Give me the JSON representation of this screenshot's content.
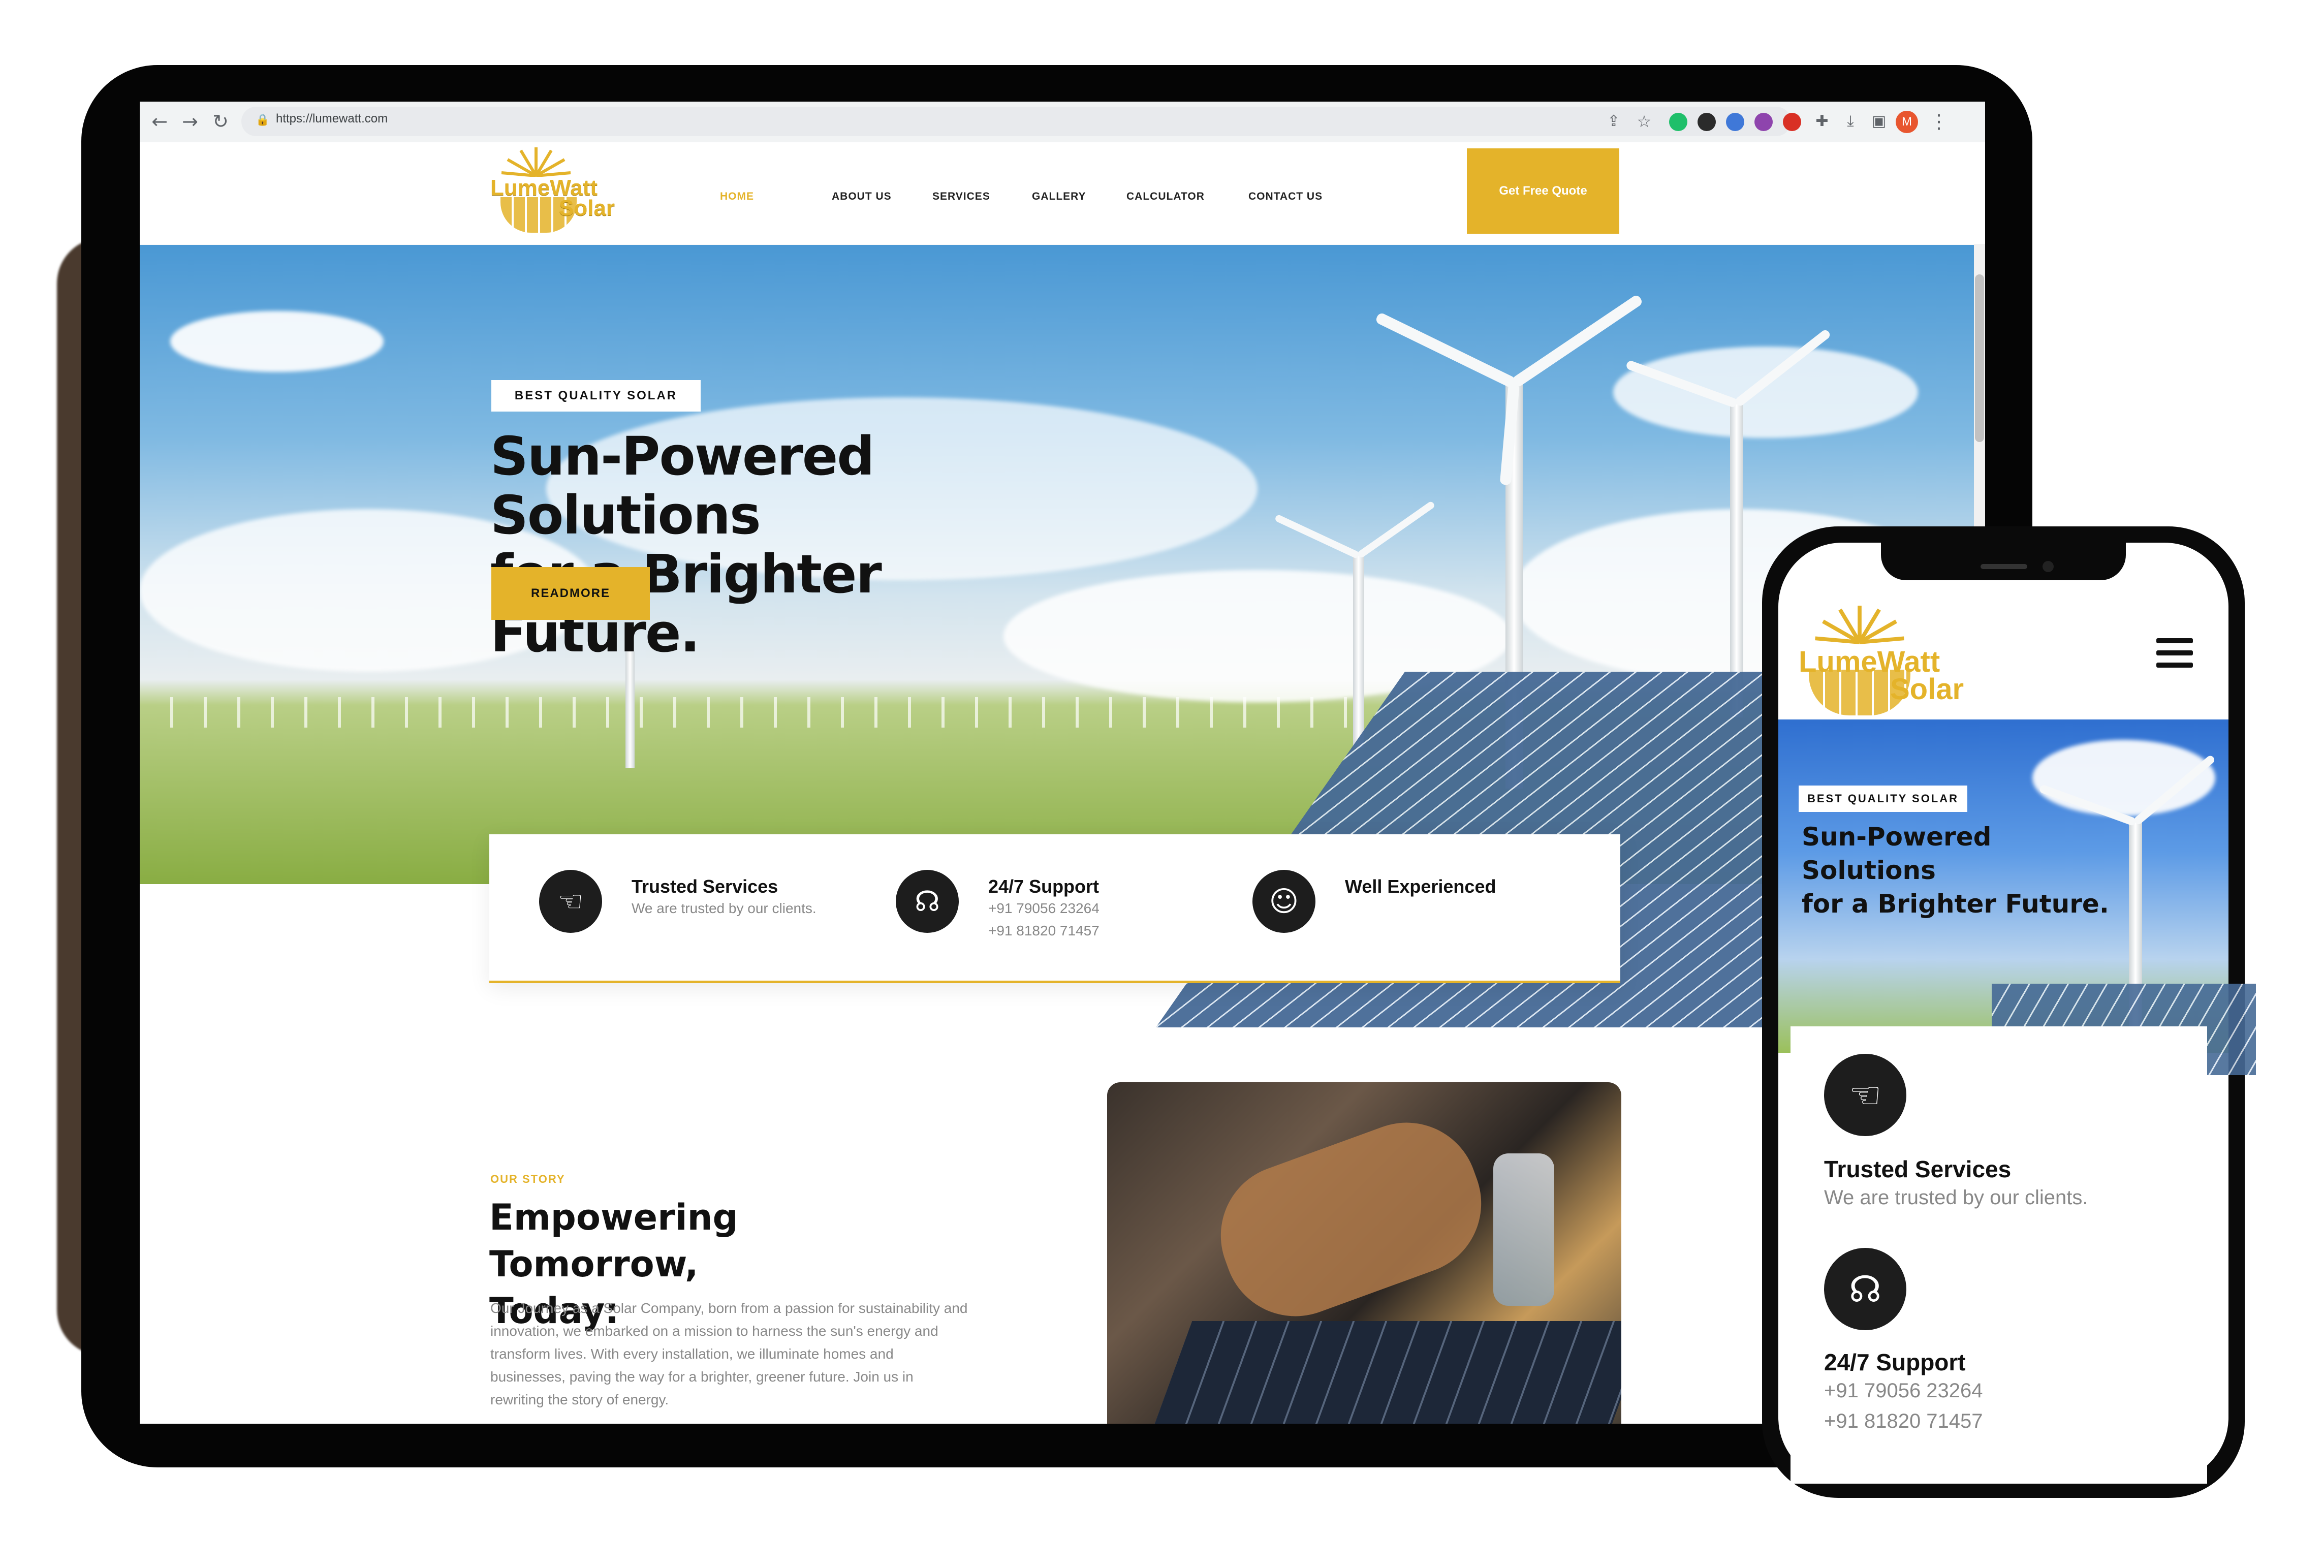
{
  "browser": {
    "url": "https://lumewatt.com",
    "avatar_letter": "M"
  },
  "brand": {
    "name_line1": "LumeWatt",
    "name_line2": "Solar",
    "accent": "#e4b32a"
  },
  "nav": {
    "items": [
      {
        "label": "HOME",
        "active": true
      },
      {
        "label": "ABOUT US"
      },
      {
        "label": "SERVICES"
      },
      {
        "label": "GALLERY"
      },
      {
        "label": "CALCULATOR"
      },
      {
        "label": "CONTACT US"
      }
    ],
    "cta": "Get Free Quote"
  },
  "hero": {
    "badge": "BEST QUALITY SOLAR",
    "title_line1": "Sun-Powered Solutions",
    "title_line2": "for a Brighter Future.",
    "button": "READMORE"
  },
  "features": [
    {
      "icon": "hand-drop-icon",
      "title": "Trusted Services",
      "lines": [
        "We are trusted by our clients."
      ]
    },
    {
      "icon": "headset-icon",
      "title": "24/7 Support",
      "lines": [
        "+91 79056 23264",
        "+91 81820 71457"
      ]
    },
    {
      "icon": "users-icon",
      "title": "Well Experienced",
      "lines": []
    }
  ],
  "story": {
    "eyebrow": "OUR STORY",
    "title_line1": "Empowering Tomorrow,",
    "title_line2": "Today:",
    "body": "Our Journey as a Solar Company, born from a passion for sustainability and innovation, we embarked on a mission to harness the sun's energy and transform lives. With every installation, we illuminate homes and businesses, paving the way for a brighter, greener future. Join us in rewriting the story of energy."
  },
  "mobile": {
    "badge": "BEST QUALITY SOLAR",
    "title_line1": "Sun-Powered Solutions",
    "title_line2": "for a Brighter Future.",
    "features": [
      {
        "title": "Trusted Services",
        "lines": [
          "We are trusted by our clients."
        ]
      },
      {
        "title": "24/7 Support",
        "lines": [
          "+91 79056 23264",
          "+91 81820 71457"
        ]
      }
    ]
  }
}
